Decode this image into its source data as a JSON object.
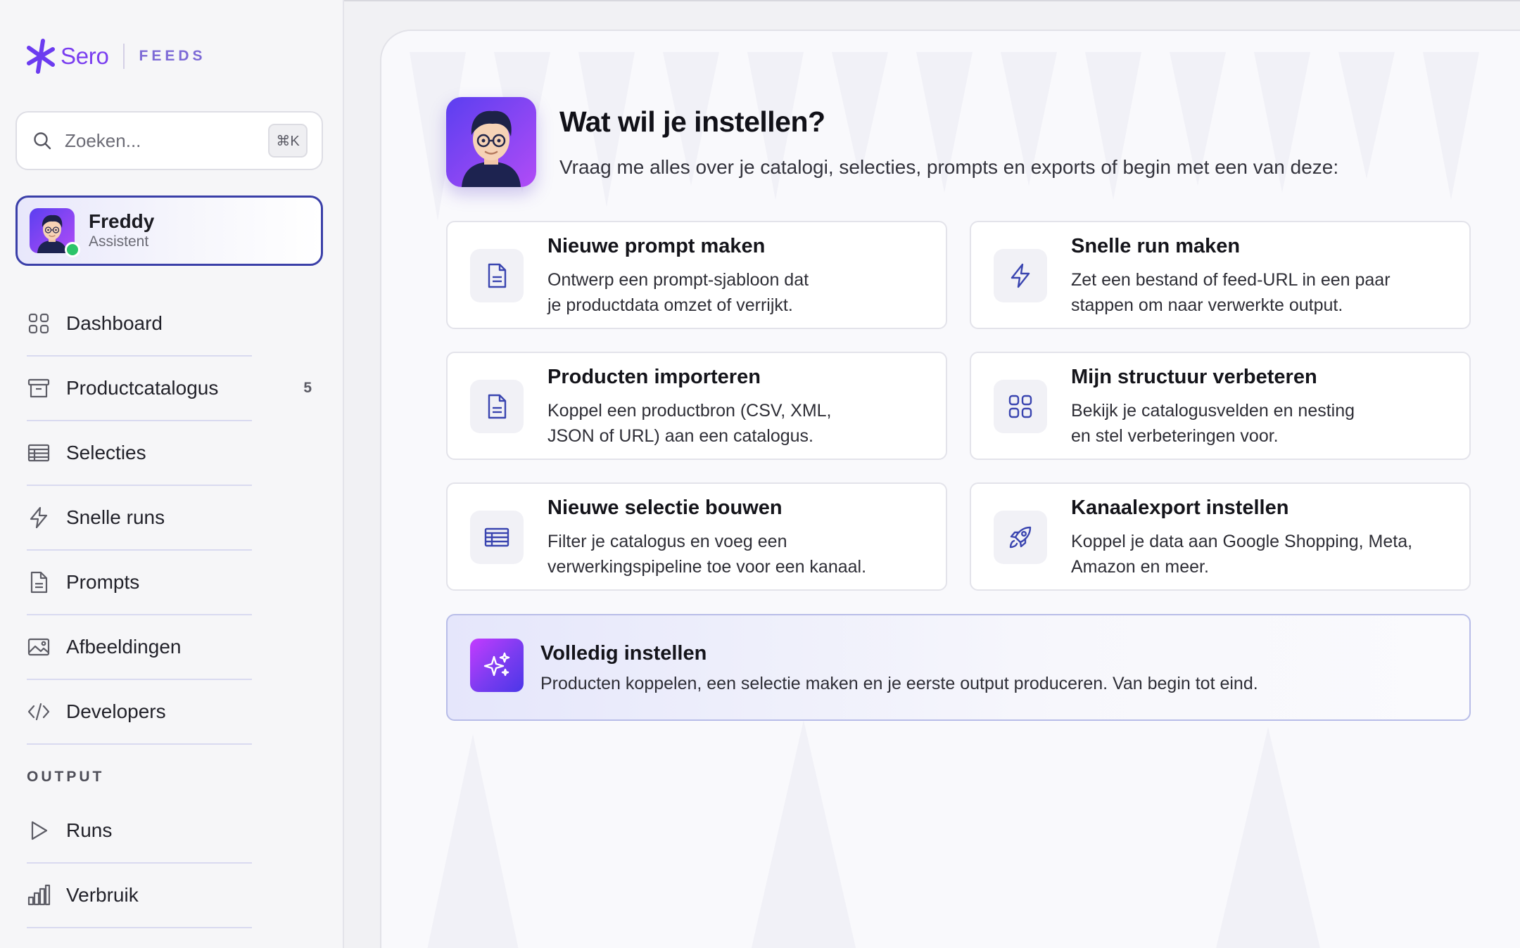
{
  "brand": {
    "name": "Sero",
    "product": "FEEDS"
  },
  "search": {
    "placeholder": "Zoeken...",
    "shortcut": "⌘K"
  },
  "assistant": {
    "name": "Freddy",
    "role": "Assistent",
    "status": "online"
  },
  "nav": {
    "items": [
      {
        "label": "Dashboard",
        "icon": "grid-icon"
      },
      {
        "label": "Productcatalogus",
        "icon": "archive-icon",
        "count": "5"
      },
      {
        "label": "Selecties",
        "icon": "table-icon"
      },
      {
        "label": "Snelle runs",
        "icon": "lightning-icon"
      },
      {
        "label": "Prompts",
        "icon": "document-icon"
      },
      {
        "label": "Afbeeldingen",
        "icon": "image-icon"
      },
      {
        "label": "Developers",
        "icon": "code-icon"
      }
    ],
    "output_section": {
      "title": "OUTPUT",
      "items": [
        {
          "label": "Runs",
          "icon": "play-icon"
        },
        {
          "label": "Verbruik",
          "icon": "bar-chart-icon"
        }
      ]
    }
  },
  "hero": {
    "title": "Wat wil je instellen?",
    "subtitle": "Vraag me alles over je catalogi, selecties, prompts en exports of begin met een van deze:"
  },
  "cards": [
    {
      "title": "Nieuwe prompt maken",
      "desc": [
        "Ontwerp een prompt-sjabloon dat",
        "je productdata omzet of verrijkt."
      ],
      "icon": "document-icon"
    },
    {
      "title": "Snelle run maken",
      "desc": [
        "Zet een bestand of feed-URL in een paar",
        "stappen om naar verwerkte output."
      ],
      "icon": "lightning-icon"
    },
    {
      "title": "Producten importeren",
      "desc": [
        "Koppel een productbron (CSV, XML,",
        "JSON of URL) aan een catalogus."
      ],
      "icon": "document-icon"
    },
    {
      "title": "Mijn structuur verbeteren",
      "desc": [
        "Bekijk je catalogusvelden en nesting",
        "en stel verbeteringen voor."
      ],
      "icon": "grid-icon"
    },
    {
      "title": "Nieuwe selectie bouwen",
      "desc": [
        "Filter je catalogus en voeg een",
        "verwerkingspipeline toe voor een kanaal."
      ],
      "icon": "table-icon"
    },
    {
      "title": "Kanaalexport instellen",
      "desc": [
        "Koppel je data aan Google Shopping, Meta,",
        "Amazon en meer."
      ],
      "icon": "rocket-icon"
    }
  ],
  "full_setup": {
    "title": "Volledig instellen",
    "desc": "Producten koppelen, een selectie maken en je eerste output produceren. Van begin tot eind.",
    "icon": "sparkles-icon"
  },
  "colors": {
    "accent": "#7a3ef0",
    "active_border": "#3a3fa8",
    "icon_blue": "#3a45b0",
    "online": "#2cc46a"
  }
}
